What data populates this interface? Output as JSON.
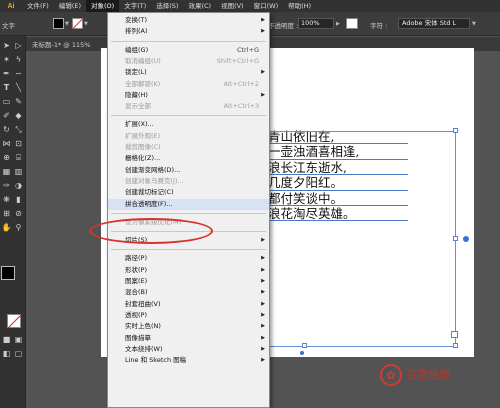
{
  "menubar": {
    "logo": "Ai",
    "items": [
      "文件(F)",
      "编辑(E)",
      "对象(O)",
      "文字(T)",
      "选择(S)",
      "效果(C)",
      "视图(V)",
      "窗口(W)",
      "帮助(H)"
    ],
    "active_index": 2
  },
  "control_bar": {
    "left_label": "文字",
    "opacity_label": "不透明度 :",
    "opacity_value": "100%",
    "character_label": "字符 :",
    "font_value": "Adobe 宋体 Std L"
  },
  "document_tab": "未标题-1* @ 115%",
  "poem_lines": [
    "青山依旧在,",
    "一壶浊酒喜相逢,",
    "浪长江东逝水,",
    "几度夕阳红。",
    "都付笑谈中。",
    "浪花淘尽英雄。"
  ],
  "object_menu": {
    "items": [
      {
        "label": "变换(T)",
        "submenu": true,
        "disabled": false
      },
      {
        "label": "排列(A)",
        "submenu": true,
        "disabled": false
      },
      {
        "sep": true
      },
      {
        "label": "编组(G)",
        "shortcut": "Ctrl+G",
        "disabled": false
      },
      {
        "label": "取消编组(U)",
        "shortcut": "Shift+Ctrl+G",
        "disabled": true
      },
      {
        "label": "锁定(L)",
        "submenu": true,
        "disabled": false
      },
      {
        "label": "全部解锁(K)",
        "shortcut": "Alt+Ctrl+2",
        "disabled": true
      },
      {
        "label": "隐藏(H)",
        "submenu": true,
        "disabled": false
      },
      {
        "label": "显示全部",
        "shortcut": "Alt+Ctrl+3",
        "disabled": true
      },
      {
        "sep": true
      },
      {
        "label": "扩展(X)...",
        "disabled": false
      },
      {
        "label": "扩展外观(E)",
        "disabled": true
      },
      {
        "label": "裁剪图像(C)",
        "disabled": true
      },
      {
        "label": "栅格化(Z)...",
        "disabled": false
      },
      {
        "label": "创建渐变网格(D)...",
        "disabled": false
      },
      {
        "label": "创建对象马赛克(J)...",
        "disabled": true
      },
      {
        "label": "创建裁切标记(C)",
        "disabled": false
      },
      {
        "label": "拼合透明度(F)...",
        "disabled": false,
        "highlighted": true
      },
      {
        "sep": true
      },
      {
        "label": "设为像素级优化(M)",
        "disabled": true
      },
      {
        "sep": true
      },
      {
        "label": "切片(S)",
        "submenu": true,
        "disabled": false
      },
      {
        "sep": true
      },
      {
        "label": "路径(P)",
        "submenu": true,
        "disabled": false
      },
      {
        "label": "形状(P)",
        "submenu": true,
        "disabled": false
      },
      {
        "label": "图案(E)",
        "submenu": true,
        "disabled": false
      },
      {
        "label": "混合(B)",
        "submenu": true,
        "disabled": false
      },
      {
        "label": "封套扭曲(V)",
        "submenu": true,
        "disabled": false
      },
      {
        "label": "透视(P)",
        "submenu": true,
        "disabled": false
      },
      {
        "label": "实时上色(N)",
        "submenu": true,
        "disabled": false
      },
      {
        "label": "图像描摹",
        "submenu": true,
        "disabled": false
      },
      {
        "label": "文本绕排(W)",
        "submenu": true,
        "disabled": false
      },
      {
        "label": "Line 和 Sketch 图稿",
        "submenu": true,
        "disabled": false
      }
    ]
  },
  "watermark": {
    "badge": "Bai",
    "text": "百度经验",
    "url": "jingyan.baidu.com"
  },
  "colors": {
    "menu_bg": "#f0f0f0",
    "highlight": "#d7e3f4",
    "annotation": "#d8332a",
    "selection": "#5a80d0"
  }
}
